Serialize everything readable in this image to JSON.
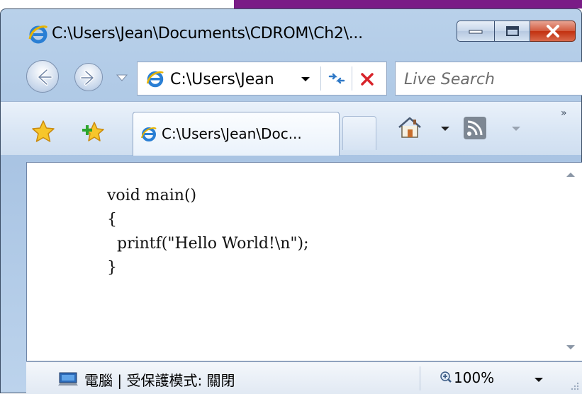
{
  "window": {
    "title": "C:\\Users\\Jean\\Documents\\CDROM\\Ch2\\..."
  },
  "address_bar": {
    "value": "C:\\Users\\Jean",
    "search_placeholder": "Live Search"
  },
  "tabs": [
    {
      "label": "C:\\Users\\Jean\\Doc..."
    }
  ],
  "toolbar": {
    "overflow_chevrons": "»"
  },
  "content": {
    "code_lines": [
      "void main()",
      "{",
      "  printf(\"Hello World!\\n\");",
      "}"
    ]
  },
  "status_bar": {
    "zone_text": "電腦 | 受保護模式: 關閉",
    "zoom": "100%"
  },
  "colors": {
    "window_frame": "#b9d1ea",
    "close_button": "#c2300f",
    "background_accent": "#7a1c86"
  },
  "icons": [
    "ie-icon",
    "back-arrow-icon",
    "forward-arrow-icon",
    "dropdown-icon",
    "refresh-icon",
    "stop-icon",
    "favorites-star-icon",
    "add-favorite-icon",
    "home-icon",
    "feed-icon",
    "computer-icon",
    "zoom-icon",
    "resize-grip-icon"
  ]
}
